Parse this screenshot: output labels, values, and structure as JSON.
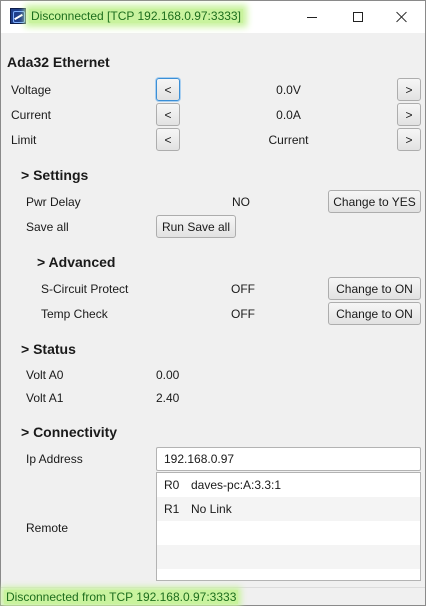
{
  "window": {
    "title": "Disconnected [TCP 192.168.0.97:3333]",
    "icon": "app-icon",
    "controls": {
      "minimize_icon": "minimize-icon",
      "maximize_icon": "maximize-icon",
      "close_icon": "close-icon"
    }
  },
  "colors": {
    "status_highlight": "#c9f39e",
    "status_text": "#1d6e1d",
    "focus_border": "#3b8fd6",
    "background": "#f0f0f0"
  },
  "device": {
    "title": "Ada32 Ethernet",
    "controls": [
      {
        "label": "Voltage",
        "prev": "<",
        "value": "0.0V",
        "next": ">"
      },
      {
        "label": "Current",
        "prev": "<",
        "value": "0.0A",
        "next": ">"
      },
      {
        "label": "Limit",
        "prev": "<",
        "value": "Current",
        "next": ">"
      }
    ]
  },
  "settings": {
    "heading": "> Settings",
    "pwr_delay": {
      "label": "Pwr Delay",
      "value": "NO",
      "button": "Change to YES"
    },
    "save_all": {
      "label": "Save all",
      "button": "Run Save all"
    }
  },
  "advanced": {
    "heading": "> Advanced",
    "rows": [
      {
        "label": "S-Circuit Protect",
        "value": "OFF",
        "button": "Change to ON"
      },
      {
        "label": "Temp Check",
        "value": "OFF",
        "button": "Change to ON"
      }
    ]
  },
  "status": {
    "heading": "> Status",
    "rows": [
      {
        "label": "Volt A0",
        "value": "0.00"
      },
      {
        "label": "Volt A1",
        "value": "2.40"
      }
    ]
  },
  "connectivity": {
    "heading": "> Connectivity",
    "ip_label": "Ip Address",
    "ip_value": "192.168.0.97",
    "remote_label": "Remote",
    "remotes": [
      {
        "id": "R0",
        "value": "daves-pc:A:3.3:1"
      },
      {
        "id": "R1",
        "value": "No Link"
      }
    ]
  },
  "statusbar": {
    "text": "Disconnected from TCP 192.168.0.97:3333"
  }
}
